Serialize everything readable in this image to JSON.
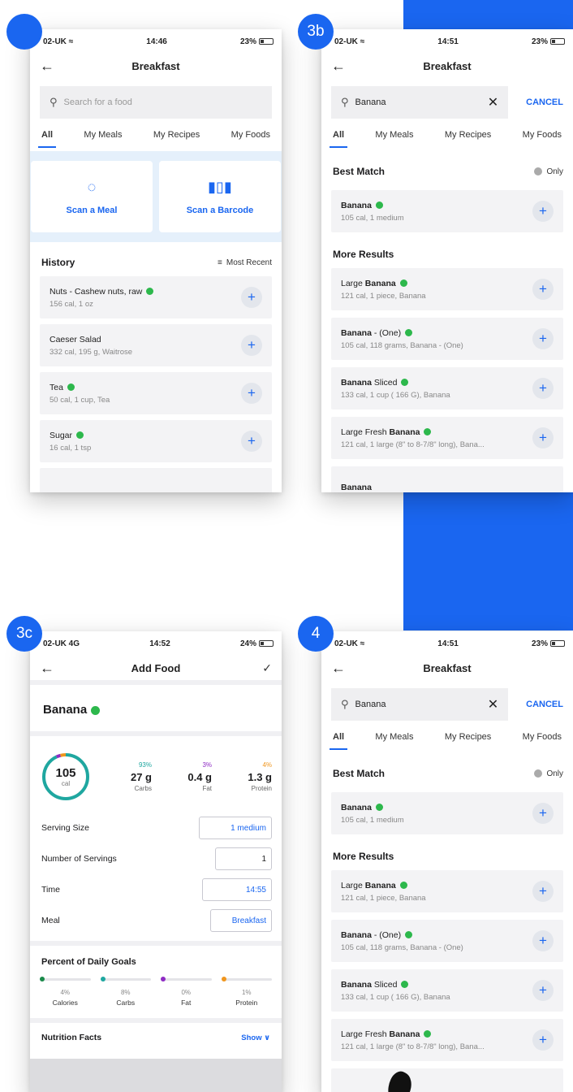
{
  "colors": {
    "accent": "#1a66f0",
    "verified": "#2db84c",
    "carbs": "#1fa7a0",
    "fat": "#8e2bc4",
    "protein": "#f0961e"
  },
  "badges": {
    "s1": "",
    "s2": "3b",
    "s3": "3c",
    "s4": "4"
  },
  "screen1": {
    "status": {
      "carrier": "02-UK",
      "time": "14:46",
      "battery": "23%"
    },
    "nav": {
      "title": "Breakfast"
    },
    "search": {
      "placeholder": "Search for a food"
    },
    "tabs": [
      "All",
      "My Meals",
      "My Recipes",
      "My Foods"
    ],
    "scan_meal": "Scan a Meal",
    "scan_barcode": "Scan a Barcode",
    "history": {
      "title": "History",
      "sort": "Most Recent"
    },
    "items": [
      {
        "name": "Nuts - Cashew nuts, raw",
        "sub": "156 cal, 1 oz"
      },
      {
        "name": "Caeser Salad",
        "sub": "332 cal, 195 g, Waitrose"
      },
      {
        "name": "Tea",
        "sub": "50 cal, 1 cup, Tea"
      },
      {
        "name": "Sugar",
        "sub": "16 cal, 1 tsp"
      }
    ]
  },
  "screen2": {
    "status": {
      "carrier": "02-UK",
      "time": "14:51",
      "battery": "23%"
    },
    "nav": {
      "title": "Breakfast"
    },
    "search": {
      "value": "Banana",
      "cancel": "CANCEL"
    },
    "tabs": [
      "All",
      "My Meals",
      "My Recipes",
      "My Foods"
    ],
    "best_match": {
      "title": "Best Match",
      "only": "Only"
    },
    "best_item": {
      "name": "Banana",
      "sub": "105 cal, 1 medium"
    },
    "more_results": "More Results",
    "results": [
      {
        "pre": "Large ",
        "bold": "Banana",
        "post": "",
        "sub": "121 cal, 1 piece, Banana"
      },
      {
        "pre": "",
        "bold": "Banana",
        "post": " - (One)",
        "sub": "105 cal, 118 grams, Banana - (One)"
      },
      {
        "pre": "",
        "bold": "Banana",
        "post": " Sliced",
        "sub": "133 cal, 1 cup ( 166 G), Banana"
      },
      {
        "pre": "Large Fresh ",
        "bold": "Banana",
        "post": "",
        "sub": "121 cal, 1 large (8\" to 8-7/8\" long), Bana..."
      },
      {
        "pre": "",
        "bold": "Banana",
        "post": "",
        "sub": ""
      }
    ]
  },
  "screen3": {
    "status": {
      "carrier": "02-UK 4G",
      "time": "14:52",
      "battery": "24%"
    },
    "nav": {
      "title": "Add Food"
    },
    "food_name": "Banana",
    "calories": {
      "value": "105",
      "unit": "cal"
    },
    "macros": [
      {
        "pct": "93%",
        "value": "27 g",
        "label": "Carbs"
      },
      {
        "pct": "3%",
        "value": "0.4 g",
        "label": "Fat"
      },
      {
        "pct": "4%",
        "value": "1.3 g",
        "label": "Protein"
      }
    ],
    "ring_fractions": {
      "carbs": 0.93,
      "fat": 0.03,
      "protein": 0.04
    },
    "rows": [
      {
        "label": "Serving Size",
        "value": "1 medium"
      },
      {
        "label": "Number of Servings",
        "value": "1"
      },
      {
        "label": "Time",
        "value": "14:55"
      },
      {
        "label": "Meal",
        "value": "Breakfast"
      }
    ],
    "goals_title": "Percent of Daily Goals",
    "goals": [
      {
        "pct": "4%",
        "label": "Calories",
        "color": "#1a8a4a"
      },
      {
        "pct": "8%",
        "label": "Carbs",
        "color": "#1fa7a0"
      },
      {
        "pct": "0%",
        "label": "Fat",
        "color": "#8e2bc4"
      },
      {
        "pct": "1%",
        "label": "Protein",
        "color": "#f0961e"
      }
    ],
    "nutrition": {
      "title": "Nutrition Facts",
      "show": "Show"
    }
  },
  "screen4": {
    "status": {
      "carrier": "02-UK",
      "time": "14:51",
      "battery": "23%"
    },
    "nav": {
      "title": "Breakfast"
    },
    "search": {
      "value": "Banana",
      "cancel": "CANCEL"
    },
    "tabs": [
      "All",
      "My Meals",
      "My Recipes",
      "My Foods"
    ],
    "best_match": {
      "title": "Best Match",
      "only": "Only"
    },
    "best_item": {
      "name": "Banana",
      "sub": "105 cal, 1 medium"
    },
    "more_results": "More Results",
    "results": [
      {
        "pre": "Large ",
        "bold": "Banana",
        "post": "",
        "sub": "121 cal, 1 piece, Banana"
      },
      {
        "pre": "",
        "bold": "Banana",
        "post": " - (One)",
        "sub": "105 cal, 118 grams, Banana - (One)"
      },
      {
        "pre": "",
        "bold": "Banana",
        "post": " Sliced",
        "sub": "133 cal, 1 cup ( 166 G), Banana"
      },
      {
        "pre": "Large Fresh ",
        "bold": "Banana",
        "post": "",
        "sub": "121 cal, 1 large (8\" to 8-7/8\" long), Bana..."
      }
    ]
  }
}
